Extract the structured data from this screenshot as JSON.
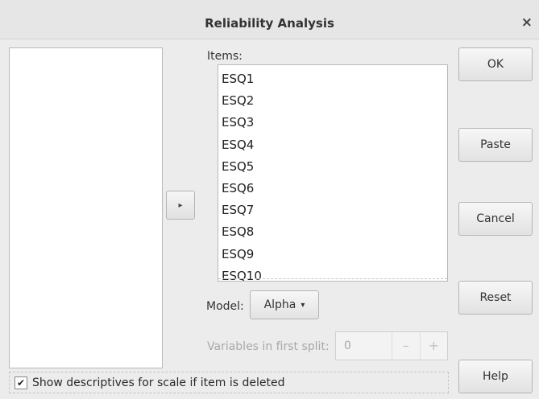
{
  "window": {
    "title": "Reliability Analysis",
    "close_glyph": "×"
  },
  "move_button": {
    "icon": "arrow-right-icon",
    "glyph": "▸"
  },
  "items": {
    "label": "Items:",
    "list": [
      "ESQ1",
      "ESQ2",
      "ESQ3",
      "ESQ4",
      "ESQ5",
      "ESQ6",
      "ESQ7",
      "ESQ8",
      "ESQ9",
      "ESQ10"
    ]
  },
  "model": {
    "label": "Model:",
    "value": "Alpha",
    "caret": "▾"
  },
  "split": {
    "label": "Variables in first split:",
    "value": "0",
    "minus": "–",
    "plus": "+"
  },
  "options": {
    "show_descriptives_label": "Show descriptives for scale if item is deleted",
    "show_descriptives_checked": true,
    "check_glyph": "✔"
  },
  "buttons": {
    "ok": "OK",
    "paste": "Paste",
    "cancel": "Cancel",
    "reset": "Reset",
    "help": "Help"
  }
}
